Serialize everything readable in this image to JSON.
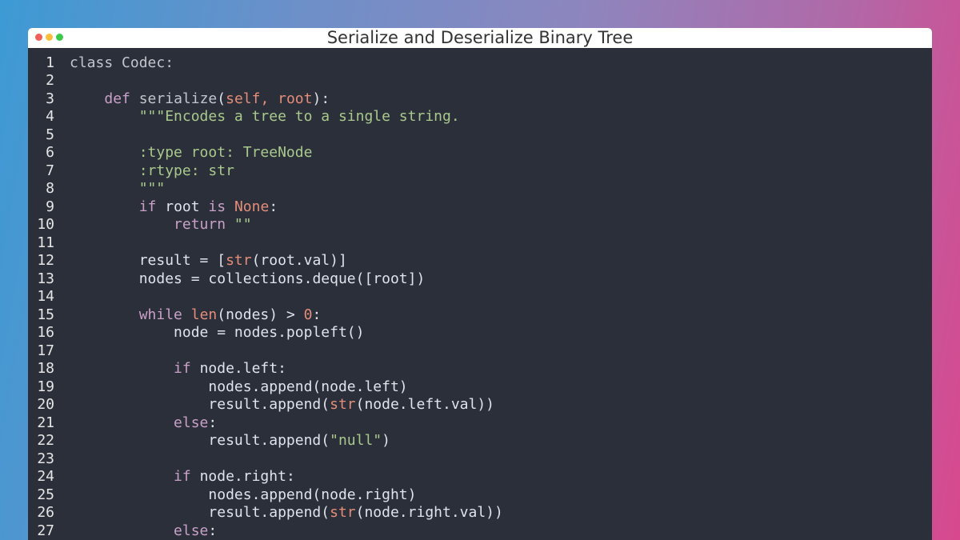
{
  "window": {
    "title": "Serialize and Deserialize Binary Tree"
  },
  "colors": {
    "keyword": "#c9a0c8",
    "builtin": "#e48d79",
    "string": "#a9c98c",
    "plain": "#dfe3ea",
    "background": "#2b2f3a"
  },
  "editor": {
    "lines": [
      {
        "n": "1",
        "tokens": [
          {
            "t": "class Codec:",
            "c": "sr"
          }
        ]
      },
      {
        "n": "2",
        "tokens": []
      },
      {
        "n": "3",
        "tokens": [
          {
            "t": "    "
          },
          {
            "t": "def",
            "c": "kw"
          },
          {
            "t": " "
          },
          {
            "t": "serialize",
            "c": "sr"
          },
          {
            "t": "(",
            "c": "pl"
          },
          {
            "t": "self, root",
            "c": "bi"
          },
          {
            "t": "):",
            "c": "pl"
          }
        ]
      },
      {
        "n": "4",
        "tokens": [
          {
            "t": "        "
          },
          {
            "t": "\"\"\"Encodes a tree to a single string.",
            "c": "st"
          }
        ]
      },
      {
        "n": "5",
        "tokens": []
      },
      {
        "n": "6",
        "tokens": [
          {
            "t": "        "
          },
          {
            "t": ":type root: TreeNode",
            "c": "st"
          }
        ]
      },
      {
        "n": "7",
        "tokens": [
          {
            "t": "        "
          },
          {
            "t": ":rtype: str",
            "c": "st"
          }
        ]
      },
      {
        "n": "8",
        "tokens": [
          {
            "t": "        "
          },
          {
            "t": "\"\"\"",
            "c": "st"
          }
        ]
      },
      {
        "n": "9",
        "tokens": [
          {
            "t": "        "
          },
          {
            "t": "if",
            "c": "kw"
          },
          {
            "t": " root ",
            "c": "pl"
          },
          {
            "t": "is",
            "c": "kw"
          },
          {
            "t": " "
          },
          {
            "t": "None",
            "c": "bi"
          },
          {
            "t": ":",
            "c": "pl"
          }
        ]
      },
      {
        "n": "10",
        "tokens": [
          {
            "t": "            "
          },
          {
            "t": "return",
            "c": "kw"
          },
          {
            "t": " "
          },
          {
            "t": "\"\"",
            "c": "st"
          }
        ]
      },
      {
        "n": "11",
        "tokens": []
      },
      {
        "n": "12",
        "tokens": [
          {
            "t": "        "
          },
          {
            "t": "result = [",
            "c": "pl"
          },
          {
            "t": "str",
            "c": "bi"
          },
          {
            "t": "(root.val)]",
            "c": "pl"
          }
        ]
      },
      {
        "n": "13",
        "tokens": [
          {
            "t": "        "
          },
          {
            "t": "nodes = collections.deque([root])",
            "c": "pl"
          }
        ]
      },
      {
        "n": "14",
        "tokens": []
      },
      {
        "n": "15",
        "tokens": [
          {
            "t": "        "
          },
          {
            "t": "while",
            "c": "kw"
          },
          {
            "t": " "
          },
          {
            "t": "len",
            "c": "bi"
          },
          {
            "t": "(nodes) > ",
            "c": "pl"
          },
          {
            "t": "0",
            "c": "bi"
          },
          {
            "t": ":",
            "c": "pl"
          }
        ]
      },
      {
        "n": "16",
        "tokens": [
          {
            "t": "            "
          },
          {
            "t": "node = nodes.popleft()",
            "c": "pl"
          }
        ]
      },
      {
        "n": "17",
        "tokens": []
      },
      {
        "n": "18",
        "tokens": [
          {
            "t": "            "
          },
          {
            "t": "if",
            "c": "kw"
          },
          {
            "t": " node.left:",
            "c": "pl"
          }
        ]
      },
      {
        "n": "19",
        "tokens": [
          {
            "t": "                "
          },
          {
            "t": "nodes.append(node.left)",
            "c": "pl"
          }
        ]
      },
      {
        "n": "20",
        "tokens": [
          {
            "t": "                "
          },
          {
            "t": "result.append(",
            "c": "pl"
          },
          {
            "t": "str",
            "c": "bi"
          },
          {
            "t": "(node.left.val))",
            "c": "pl"
          }
        ]
      },
      {
        "n": "21",
        "tokens": [
          {
            "t": "            "
          },
          {
            "t": "else",
            "c": "kw"
          },
          {
            "t": ":",
            "c": "pl"
          }
        ]
      },
      {
        "n": "22",
        "tokens": [
          {
            "t": "                "
          },
          {
            "t": "result.append(",
            "c": "pl"
          },
          {
            "t": "\"null\"",
            "c": "st"
          },
          {
            "t": ")",
            "c": "pl"
          }
        ]
      },
      {
        "n": "23",
        "tokens": []
      },
      {
        "n": "24",
        "tokens": [
          {
            "t": "            "
          },
          {
            "t": "if",
            "c": "kw"
          },
          {
            "t": " node.right:",
            "c": "pl"
          }
        ]
      },
      {
        "n": "25",
        "tokens": [
          {
            "t": "                "
          },
          {
            "t": "nodes.append(node.right)",
            "c": "pl"
          }
        ]
      },
      {
        "n": "26",
        "tokens": [
          {
            "t": "                "
          },
          {
            "t": "result.append(",
            "c": "pl"
          },
          {
            "t": "str",
            "c": "bi"
          },
          {
            "t": "(node.right.val))",
            "c": "pl"
          }
        ]
      },
      {
        "n": "27",
        "tokens": [
          {
            "t": "            "
          },
          {
            "t": "else",
            "c": "kw"
          },
          {
            "t": ":",
            "c": "pl"
          }
        ]
      }
    ]
  }
}
